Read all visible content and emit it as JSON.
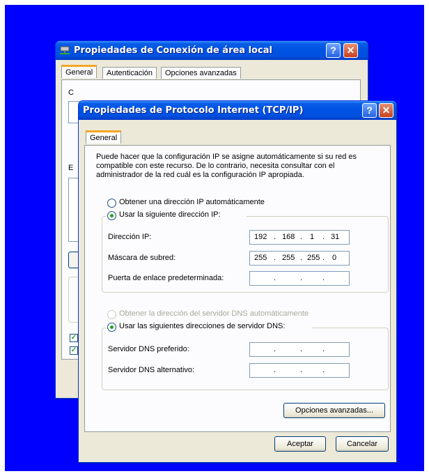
{
  "back_window": {
    "title": "Propiedades de Conexión de área local",
    "tabs": [
      "General",
      "Autenticación",
      "Opciones avanzadas"
    ],
    "partial_labels": [
      "C",
      "E"
    ]
  },
  "front_window": {
    "title": "Propiedades de Protocolo Internet (TCP/IP)",
    "tab": "General",
    "description": "Puede hacer que la configuración IP se asigne automáticamente si su red es compatible con este recurso. De lo contrario, necesita consultar con el administrador de la red cuál es la configuración IP apropiada.",
    "ip_auto_label": "Obtener una dirección IP automáticamente",
    "ip_manual_label": "Usar la siguiente dirección IP:",
    "ip_address_label": "Dirección IP:",
    "ip_address": [
      "192",
      "168",
      "1",
      "31"
    ],
    "subnet_label": "Máscara de subred:",
    "subnet": [
      "255",
      "255",
      "255",
      "0"
    ],
    "gateway_label": "Puerta de enlace predeterminada:",
    "gateway": [
      "",
      "",
      "",
      ""
    ],
    "dns_auto_label": "Obtener la dirección del servidor DNS automáticamente",
    "dns_manual_label": "Usar las siguientes direcciones de servidor DNS:",
    "dns_pref_label": "Servidor DNS preferido:",
    "dns_pref": [
      "",
      "",
      "",
      ""
    ],
    "dns_alt_label": "Servidor DNS alternativo:",
    "dns_alt": [
      "",
      "",
      "",
      ""
    ],
    "advanced_button": "Opciones avanzadas...",
    "ok_button": "Aceptar",
    "cancel_button": "Cancelar",
    "help_glyph": "?",
    "close_glyph": "✕"
  },
  "colors": {
    "desktop": "#0000fe",
    "titlebar": "#0054e3",
    "dialog": "#ece9d8"
  }
}
